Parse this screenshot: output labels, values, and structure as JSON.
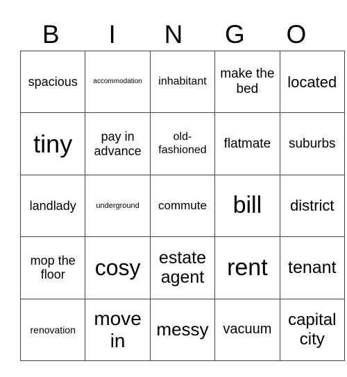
{
  "header": [
    "B",
    "I",
    "N",
    "G",
    "O"
  ],
  "rows": [
    [
      {
        "text": "spacious",
        "size": 18
      },
      {
        "text": "accommodation",
        "size": 10
      },
      {
        "text": "inhabitant",
        "size": 16
      },
      {
        "text": "make the bed",
        "size": 19
      },
      {
        "text": "located",
        "size": 22
      }
    ],
    [
      {
        "text": "tiny",
        "size": 36
      },
      {
        "text": "pay in advance",
        "size": 18
      },
      {
        "text": "old-fashioned",
        "size": 16
      },
      {
        "text": "flatmate",
        "size": 19
      },
      {
        "text": "suburbs",
        "size": 19
      }
    ],
    [
      {
        "text": "landlady",
        "size": 18
      },
      {
        "text": "underground",
        "size": 11
      },
      {
        "text": "commute",
        "size": 17
      },
      {
        "text": "bill",
        "size": 34
      },
      {
        "text": "district",
        "size": 22
      }
    ],
    [
      {
        "text": "mop the floor",
        "size": 18
      },
      {
        "text": "cosy",
        "size": 32
      },
      {
        "text": "estate agent",
        "size": 25
      },
      {
        "text": "rent",
        "size": 34
      },
      {
        "text": "tenant",
        "size": 25
      }
    ],
    [
      {
        "text": "renovation",
        "size": 14
      },
      {
        "text": "move in",
        "size": 28
      },
      {
        "text": "messy",
        "size": 26
      },
      {
        "text": "vacuum",
        "size": 20
      },
      {
        "text": "capital city",
        "size": 24
      }
    ]
  ]
}
